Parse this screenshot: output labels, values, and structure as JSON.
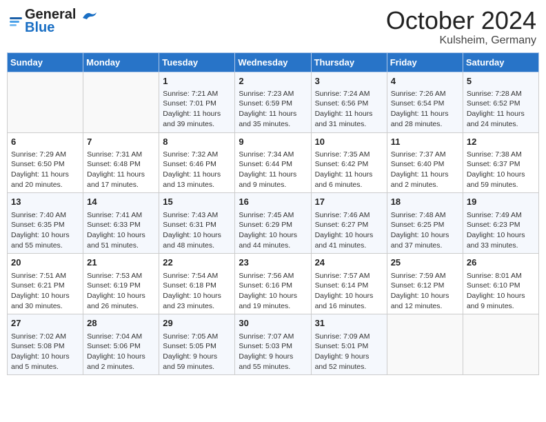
{
  "header": {
    "logo_text_general": "General",
    "logo_text_blue": "Blue",
    "month_title": "October 2024",
    "subtitle": "Kulsheim, Germany"
  },
  "days_of_week": [
    "Sunday",
    "Monday",
    "Tuesday",
    "Wednesday",
    "Thursday",
    "Friday",
    "Saturday"
  ],
  "weeks": [
    [
      {
        "day": "",
        "info": ""
      },
      {
        "day": "",
        "info": ""
      },
      {
        "day": "1",
        "info": "Sunrise: 7:21 AM\nSunset: 7:01 PM\nDaylight: 11 hours and 39 minutes."
      },
      {
        "day": "2",
        "info": "Sunrise: 7:23 AM\nSunset: 6:59 PM\nDaylight: 11 hours and 35 minutes."
      },
      {
        "day": "3",
        "info": "Sunrise: 7:24 AM\nSunset: 6:56 PM\nDaylight: 11 hours and 31 minutes."
      },
      {
        "day": "4",
        "info": "Sunrise: 7:26 AM\nSunset: 6:54 PM\nDaylight: 11 hours and 28 minutes."
      },
      {
        "day": "5",
        "info": "Sunrise: 7:28 AM\nSunset: 6:52 PM\nDaylight: 11 hours and 24 minutes."
      }
    ],
    [
      {
        "day": "6",
        "info": "Sunrise: 7:29 AM\nSunset: 6:50 PM\nDaylight: 11 hours and 20 minutes."
      },
      {
        "day": "7",
        "info": "Sunrise: 7:31 AM\nSunset: 6:48 PM\nDaylight: 11 hours and 17 minutes."
      },
      {
        "day": "8",
        "info": "Sunrise: 7:32 AM\nSunset: 6:46 PM\nDaylight: 11 hours and 13 minutes."
      },
      {
        "day": "9",
        "info": "Sunrise: 7:34 AM\nSunset: 6:44 PM\nDaylight: 11 hours and 9 minutes."
      },
      {
        "day": "10",
        "info": "Sunrise: 7:35 AM\nSunset: 6:42 PM\nDaylight: 11 hours and 6 minutes."
      },
      {
        "day": "11",
        "info": "Sunrise: 7:37 AM\nSunset: 6:40 PM\nDaylight: 11 hours and 2 minutes."
      },
      {
        "day": "12",
        "info": "Sunrise: 7:38 AM\nSunset: 6:37 PM\nDaylight: 10 hours and 59 minutes."
      }
    ],
    [
      {
        "day": "13",
        "info": "Sunrise: 7:40 AM\nSunset: 6:35 PM\nDaylight: 10 hours and 55 minutes."
      },
      {
        "day": "14",
        "info": "Sunrise: 7:41 AM\nSunset: 6:33 PM\nDaylight: 10 hours and 51 minutes."
      },
      {
        "day": "15",
        "info": "Sunrise: 7:43 AM\nSunset: 6:31 PM\nDaylight: 10 hours and 48 minutes."
      },
      {
        "day": "16",
        "info": "Sunrise: 7:45 AM\nSunset: 6:29 PM\nDaylight: 10 hours and 44 minutes."
      },
      {
        "day": "17",
        "info": "Sunrise: 7:46 AM\nSunset: 6:27 PM\nDaylight: 10 hours and 41 minutes."
      },
      {
        "day": "18",
        "info": "Sunrise: 7:48 AM\nSunset: 6:25 PM\nDaylight: 10 hours and 37 minutes."
      },
      {
        "day": "19",
        "info": "Sunrise: 7:49 AM\nSunset: 6:23 PM\nDaylight: 10 hours and 33 minutes."
      }
    ],
    [
      {
        "day": "20",
        "info": "Sunrise: 7:51 AM\nSunset: 6:21 PM\nDaylight: 10 hours and 30 minutes."
      },
      {
        "day": "21",
        "info": "Sunrise: 7:53 AM\nSunset: 6:19 PM\nDaylight: 10 hours and 26 minutes."
      },
      {
        "day": "22",
        "info": "Sunrise: 7:54 AM\nSunset: 6:18 PM\nDaylight: 10 hours and 23 minutes."
      },
      {
        "day": "23",
        "info": "Sunrise: 7:56 AM\nSunset: 6:16 PM\nDaylight: 10 hours and 19 minutes."
      },
      {
        "day": "24",
        "info": "Sunrise: 7:57 AM\nSunset: 6:14 PM\nDaylight: 10 hours and 16 minutes."
      },
      {
        "day": "25",
        "info": "Sunrise: 7:59 AM\nSunset: 6:12 PM\nDaylight: 10 hours and 12 minutes."
      },
      {
        "day": "26",
        "info": "Sunrise: 8:01 AM\nSunset: 6:10 PM\nDaylight: 10 hours and 9 minutes."
      }
    ],
    [
      {
        "day": "27",
        "info": "Sunrise: 7:02 AM\nSunset: 5:08 PM\nDaylight: 10 hours and 5 minutes."
      },
      {
        "day": "28",
        "info": "Sunrise: 7:04 AM\nSunset: 5:06 PM\nDaylight: 10 hours and 2 minutes."
      },
      {
        "day": "29",
        "info": "Sunrise: 7:05 AM\nSunset: 5:05 PM\nDaylight: 9 hours and 59 minutes."
      },
      {
        "day": "30",
        "info": "Sunrise: 7:07 AM\nSunset: 5:03 PM\nDaylight: 9 hours and 55 minutes."
      },
      {
        "day": "31",
        "info": "Sunrise: 7:09 AM\nSunset: 5:01 PM\nDaylight: 9 hours and 52 minutes."
      },
      {
        "day": "",
        "info": ""
      },
      {
        "day": "",
        "info": ""
      }
    ]
  ]
}
